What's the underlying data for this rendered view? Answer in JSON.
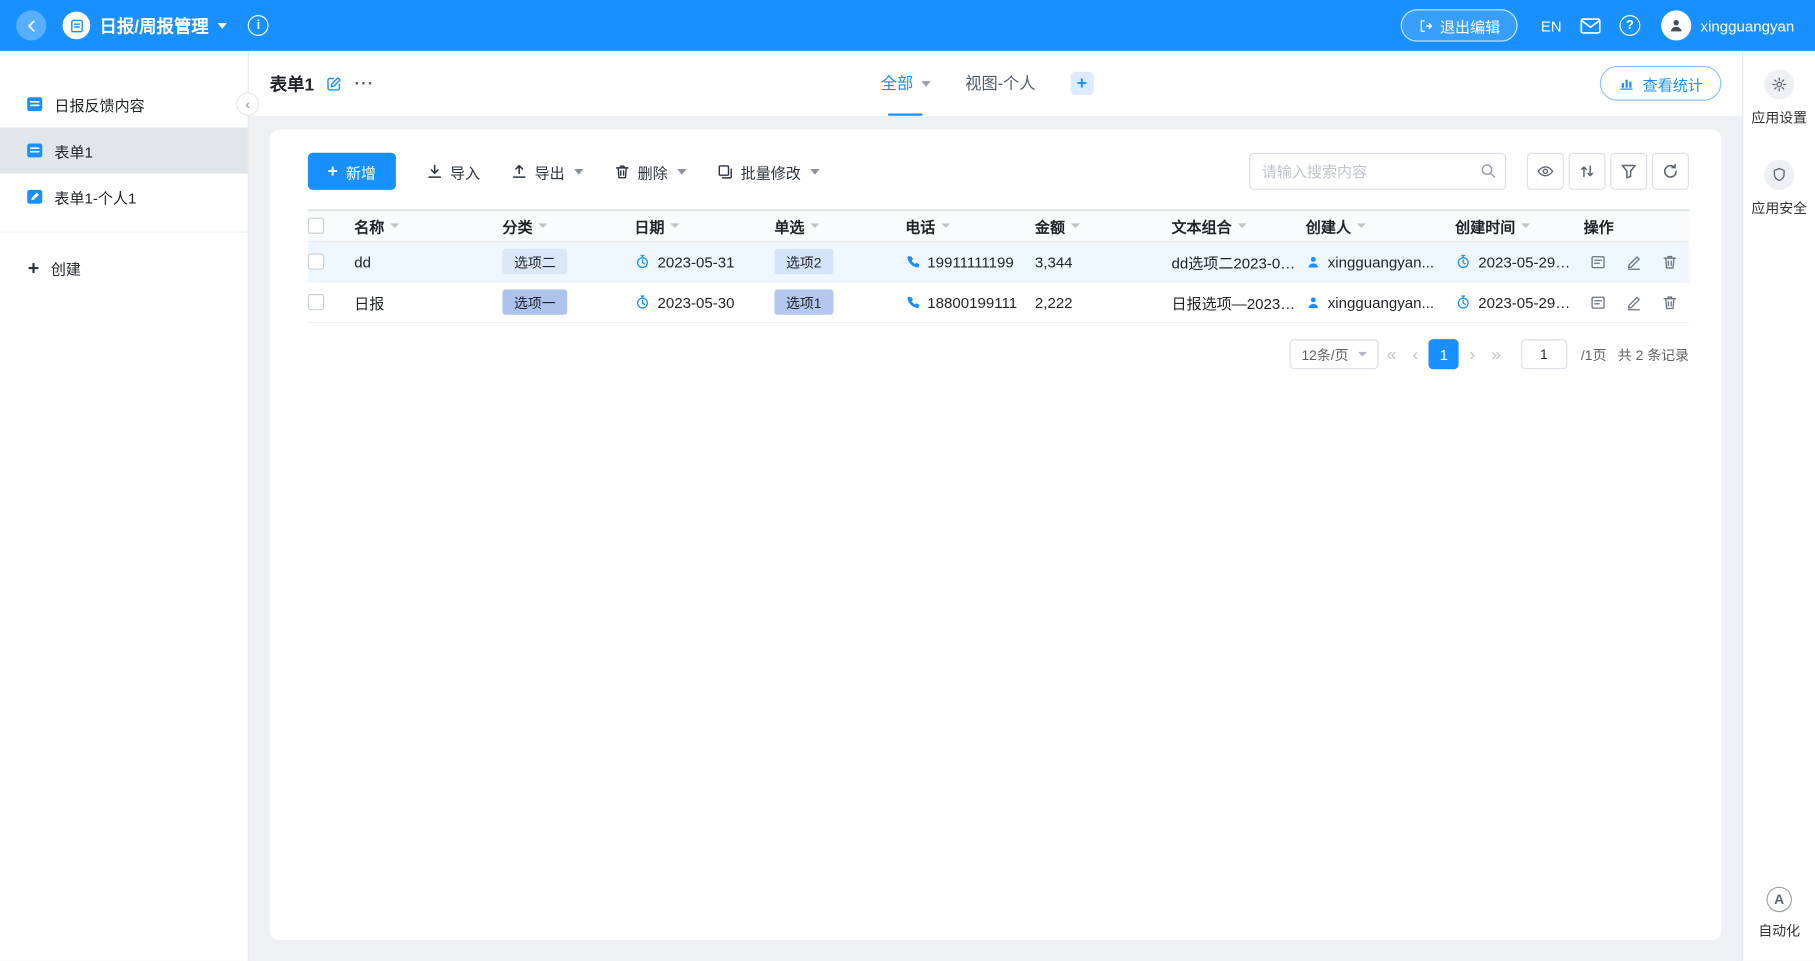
{
  "header": {
    "app_title": "日报/周报管理",
    "exit_edit_label": "退出编辑",
    "lang_label": "EN",
    "username": "xingguangyan"
  },
  "sidebar": {
    "items": [
      {
        "label": "日报反馈内容"
      },
      {
        "label": "表单1"
      },
      {
        "label": "表单1-个人1"
      }
    ],
    "create_label": "创建"
  },
  "view_bar": {
    "title": "表单1",
    "tabs": [
      {
        "label": "全部"
      },
      {
        "label": "视图-个人"
      }
    ],
    "stats_label": "查看统计"
  },
  "toolbar": {
    "add_label": "新增",
    "import_label": "导入",
    "export_label": "导出",
    "delete_label": "删除",
    "batch_label": "批量修改",
    "search_placeholder": "请输入搜索内容"
  },
  "table": {
    "columns": {
      "name": "名称",
      "category": "分类",
      "date": "日期",
      "single": "单选",
      "phone": "电话",
      "amount": "金额",
      "text": "文本组合",
      "creator": "创建人",
      "created": "创建时间",
      "actions": "操作"
    },
    "rows": [
      {
        "name": "dd",
        "category": "选项二",
        "category_bg": "#d9e7f8",
        "date": "2023-05-31",
        "single": "选项2",
        "single_bg": "#d4e4f9",
        "phone": "19911111199",
        "amount": "3,344",
        "text": "dd选项二2023-05...",
        "creator": "xingguangyan...",
        "created": "2023-05-29 2..."
      },
      {
        "name": "日报",
        "category": "选项一",
        "category_bg": "#aec3ec",
        "date": "2023-05-30",
        "single": "选项1",
        "single_bg": "#b3c7ef",
        "phone": "18800199111",
        "amount": "2,222",
        "text": "日报选项—2023-...",
        "creator": "xingguangyan...",
        "created": "2023-05-29 2..."
      }
    ]
  },
  "pagination": {
    "page_size": "12条/页",
    "current_page": "1",
    "jump_value": "1",
    "page_total": "/1页",
    "record_total": "共 2 条记录"
  },
  "right_rail": {
    "settings_label": "应用设置",
    "security_label": "应用安全",
    "automation_label": "自动化"
  },
  "icons": {
    "plus": "+",
    "more": "···",
    "collapse": "‹",
    "first_page": "«",
    "prev_page": "‹",
    "next_page": "›",
    "last_page": "»",
    "question": "?",
    "info": "i",
    "automation_letter": "A"
  },
  "colors": {
    "primary": "#1890ff",
    "header_bg": "#1890ff",
    "row_highlight": "#eef6ff"
  }
}
